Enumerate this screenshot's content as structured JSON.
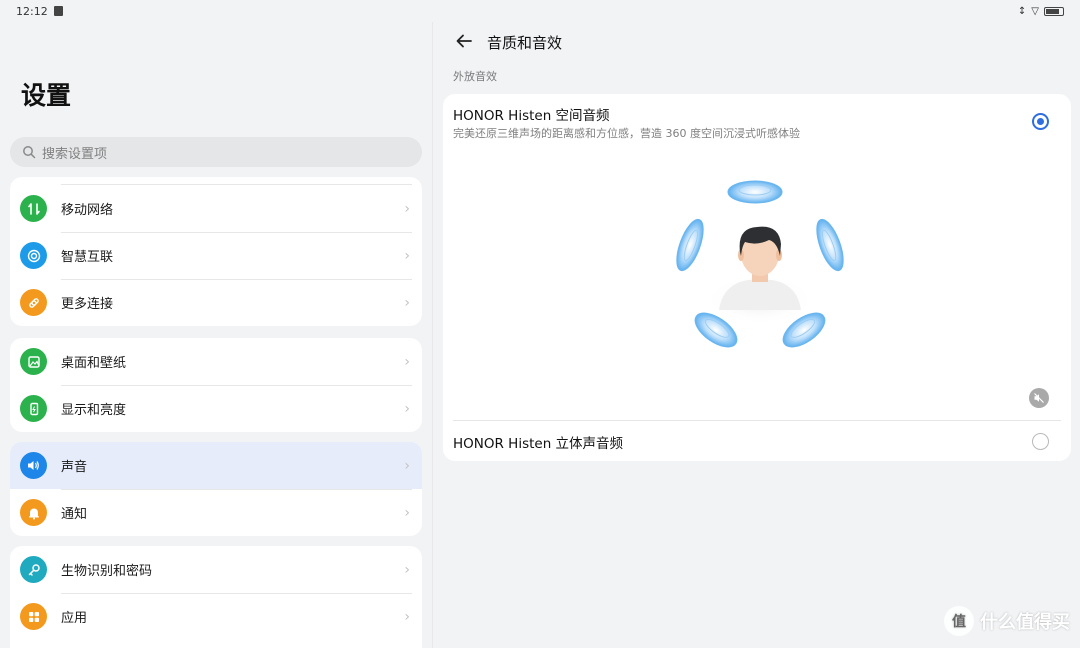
{
  "status": {
    "time": "12:12"
  },
  "settings": {
    "title": "设置",
    "search_placeholder": "搜索设置项",
    "groups": [
      {
        "items": [
          {
            "label": "移动网络",
            "icon": "mobile-data-icon",
            "color": "#2bb24c"
          },
          {
            "label": "智慧互联",
            "icon": "smart-connect-icon",
            "color": "#1e9be8"
          },
          {
            "label": "更多连接",
            "icon": "link-icon",
            "color": "#f39a1e"
          }
        ]
      },
      {
        "items": [
          {
            "label": "桌面和壁纸",
            "icon": "wallpaper-icon",
            "color": "#2bb24c"
          },
          {
            "label": "显示和亮度",
            "icon": "display-icon",
            "color": "#2bb24c"
          }
        ]
      },
      {
        "items": [
          {
            "label": "声音",
            "icon": "speaker-icon",
            "color": "#1e86e8",
            "selected": true
          },
          {
            "label": "通知",
            "icon": "bell-icon",
            "color": "#f39a1e"
          }
        ]
      },
      {
        "items": [
          {
            "label": "生物识别和密码",
            "icon": "key-icon",
            "color": "#1faabf"
          },
          {
            "label": "应用",
            "icon": "apps-icon",
            "color": "#f39a1e"
          }
        ]
      }
    ]
  },
  "detail": {
    "title": "音质和音效",
    "section_label": "外放音效",
    "option1": {
      "title": "HONOR Histen 空间音频",
      "subtitle": "完美还原三维声场的距离感和方位感，营造 360 度空间沉浸式听感体验",
      "selected": true
    },
    "option2": {
      "title": "HONOR Histen 立体声音频",
      "selected": false
    },
    "accent_color": "#2f6ee0"
  },
  "watermark": {
    "text": "什么值得买",
    "badge": "值"
  }
}
